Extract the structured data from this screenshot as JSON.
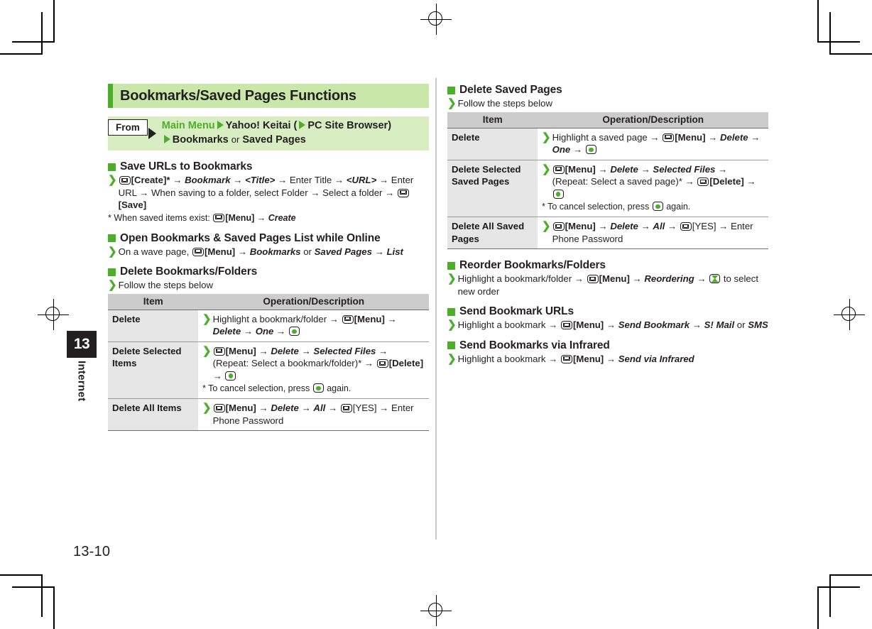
{
  "page": {
    "number": "13-10",
    "chapter_number": "13",
    "chapter_name": "Internet"
  },
  "banner": {
    "title": "Bookmarks/Saved Pages Functions"
  },
  "frombox": {
    "tag": "From",
    "line1_a": "Main Menu",
    "line1_b": "Yahoo! Keitai (",
    "line1_c": "PC Site Browser)",
    "line2_a": "Bookmarks",
    "line2_or": "or",
    "line2_b": "Saved Pages"
  },
  "left": {
    "sec_save": {
      "heading": "Save URLs to Bookmarks",
      "step": {
        "p1": "[Create]* → ",
        "i1": "Bookmark",
        "p2": " → ",
        "i2": "<Title>",
        "p3": " → Enter Title → ",
        "i3": "<URL>",
        "p4": " → Enter URL → When saving to a folder, select Folder → Select a folder → ",
        "p5": "[Save]"
      },
      "note_a": "* When saved items exist: ",
      "note_b": "[Menu] → ",
      "note_i": "Create"
    },
    "sec_open": {
      "heading": "Open Bookmarks & Saved Pages List while Online",
      "step_a": "On a wave page, ",
      "step_b": "[Menu] → ",
      "step_i1": "Bookmarks",
      "step_or": " or ",
      "step_i2": "Saved Pages",
      "step_c": " → ",
      "step_i3": "List"
    },
    "sec_delete": {
      "heading": "Delete Bookmarks/Folders",
      "intro": "Follow the steps below",
      "table": {
        "headers": [
          "Item",
          "Operation/Description"
        ],
        "rows": [
          {
            "item": "Delete",
            "l1_a": "Highlight a bookmark/folder → ",
            "l1_b": "[Menu] → ",
            "l2_i1": "Delete",
            "l2_mid": " → ",
            "l2_i2": "One",
            "l2_end": " → "
          },
          {
            "item": "Delete Selected Items",
            "l1_a": "[Menu] → ",
            "l1_i1": "Delete",
            "l1_mid": " → ",
            "l1_i2": "Selected Files",
            "l1_end": " →",
            "l2_a": "(Repeat: Select a bookmark/folder)* → ",
            "l2_b": "[Delete] → ",
            "note": "* To cancel selection, press",
            "note_end": "again."
          },
          {
            "item": "Delete All Items",
            "l1_a": "[Menu] → ",
            "l1_i1": "Delete",
            "l1_mid": " → ",
            "l1_i2": "All",
            "l1_end": " → ",
            "l1_b": "[YES] → Enter Phone Password"
          }
        ]
      }
    }
  },
  "right": {
    "sec_delete_saved": {
      "heading": "Delete Saved Pages",
      "intro": "Follow the steps below",
      "table": {
        "headers": [
          "Item",
          "Operation/Description"
        ],
        "rows": [
          {
            "item": "Delete",
            "l1_a": "Highlight a saved page → ",
            "l1_b": "[Menu] → ",
            "l1_i1": "Delete",
            "l1_end": " →",
            "l2_i2": "One",
            "l2_end": " → "
          },
          {
            "item": "Delete Selected Saved Pages",
            "l1_a": "[Menu] → ",
            "l1_i1": "Delete",
            "l1_mid": " → ",
            "l1_i2": "Selected Files",
            "l1_end": " →",
            "l2_a": "(Repeat: Select a saved page)* → ",
            "l2_b": "[Delete] →",
            "note": "* To cancel selection, press",
            "note_end": "again."
          },
          {
            "item": "Delete All Saved Pages",
            "l1_a": "[Menu] → ",
            "l1_i1": "Delete",
            "l1_mid": " → ",
            "l1_i2": "All",
            "l1_end": " → ",
            "l1_b": "[YES] → Enter Phone Password"
          }
        ]
      }
    },
    "sec_reorder": {
      "heading": "Reorder Bookmarks/Folders",
      "s_a": "Highlight a bookmark/folder → ",
      "s_b": "[Menu] → ",
      "s_i": "Reordering",
      "s_c": " → ",
      "s_d": " to select new order"
    },
    "sec_send_urls": {
      "heading": "Send Bookmark URLs",
      "s_a": "Highlight a bookmark → ",
      "s_b": "[Menu] → ",
      "s_i1": "Send Bookmark",
      "s_mid": " → ",
      "s_i2": "S! Mail",
      "s_or": " or ",
      "s_i3": "SMS"
    },
    "sec_send_ir": {
      "heading": "Send Bookmarks via Infrared",
      "s_a": "Highlight a bookmark → ",
      "s_b": "[Menu] → ",
      "s_i": "Send via Infrared"
    }
  },
  "colors": {
    "accent_green": "#4caf29",
    "banner_bg": "#c8e7a8",
    "frombox_bg": "#d9edc3",
    "table_header_bg": "#cccccc",
    "table_item_bg": "#e6e6e6",
    "chapter_tab_bg": "#231f20"
  }
}
